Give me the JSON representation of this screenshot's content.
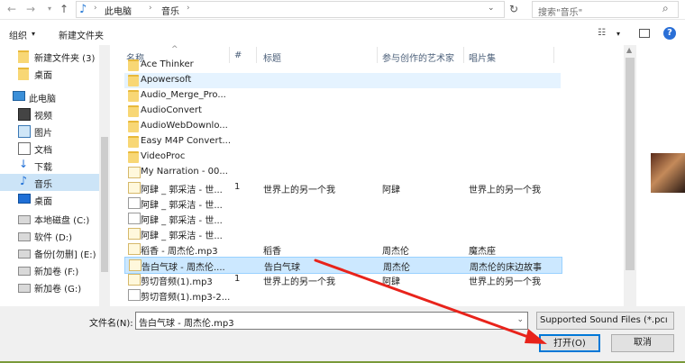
{
  "address": {
    "breadcrumbs": [
      "此电脑",
      "音乐"
    ],
    "search_placeholder": "搜索\"音乐\""
  },
  "toolbar": {
    "organize": "组织",
    "new_folder": "新建文件夹"
  },
  "sidebar": {
    "items": [
      {
        "label": "新建文件夹 (3)",
        "icon": "folder-icon"
      },
      {
        "label": "桌面",
        "icon": "folder-icon"
      },
      {
        "label": "此电脑",
        "icon": "computer-icon"
      },
      {
        "label": "视频",
        "icon": "video-icon"
      },
      {
        "label": "图片",
        "icon": "pictures-icon"
      },
      {
        "label": "文档",
        "icon": "documents-icon"
      },
      {
        "label": "下载",
        "icon": "download-icon"
      },
      {
        "label": "音乐",
        "icon": "music-icon",
        "selected": true
      },
      {
        "label": "桌面",
        "icon": "desktop-icon"
      },
      {
        "label": "本地磁盘 (C:)",
        "icon": "drive-icon"
      },
      {
        "label": "软件 (D:)",
        "icon": "drive-icon"
      },
      {
        "label": "备份[勿删] (E:)",
        "icon": "drive-icon"
      },
      {
        "label": "新加卷 (F:)",
        "icon": "drive-icon"
      },
      {
        "label": "新加卷 (G:)",
        "icon": "drive-icon"
      }
    ]
  },
  "columns": {
    "name": "名称",
    "num": "#",
    "title": "标题",
    "artist": "参与创作的艺术家",
    "album": "唱片集"
  },
  "files": [
    {
      "name": "Ace Thinker",
      "type": "folder",
      "num": "",
      "title": "",
      "artist": "",
      "album": ""
    },
    {
      "name": "Apowersoft",
      "type": "folder",
      "num": "",
      "title": "",
      "artist": "",
      "album": "",
      "hover": true
    },
    {
      "name": "Audio_Merge_Pro...",
      "type": "folder",
      "num": "",
      "title": "",
      "artist": "",
      "album": ""
    },
    {
      "name": "AudioConvert",
      "type": "folder",
      "num": "",
      "title": "",
      "artist": "",
      "album": ""
    },
    {
      "name": "AudioWebDownlo...",
      "type": "folder",
      "num": "",
      "title": "",
      "artist": "",
      "album": ""
    },
    {
      "name": "Easy M4P Convert...",
      "type": "folder",
      "num": "",
      "title": "",
      "artist": "",
      "album": ""
    },
    {
      "name": "VideoProc",
      "type": "folder",
      "num": "",
      "title": "",
      "artist": "",
      "album": ""
    },
    {
      "name": "My Narration - 00...",
      "type": "music",
      "num": "",
      "title": "",
      "artist": "",
      "album": ""
    },
    {
      "name": "阿肆 _ 郭采洁 - 世...",
      "type": "music",
      "num": "1",
      "title": "世界上的另一个我",
      "artist": "阿肆",
      "album": "世界上的另一个我"
    },
    {
      "name": "阿肆 _ 郭采洁 - 世...",
      "type": "doc",
      "num": "",
      "title": "",
      "artist": "",
      "album": ""
    },
    {
      "name": "阿肆 _ 郭采洁 - 世...",
      "type": "doc",
      "num": "",
      "title": "",
      "artist": "",
      "album": ""
    },
    {
      "name": "阿肆 _ 郭采洁 - 世...",
      "type": "music",
      "num": "",
      "title": "",
      "artist": "",
      "album": ""
    },
    {
      "name": "稻香 - 周杰伦.mp3",
      "type": "music",
      "num": "",
      "title": "稻香",
      "artist": "周杰伦",
      "album": "魔杰座"
    },
    {
      "name": "告白气球 - 周杰伦....",
      "type": "music",
      "num": "",
      "title": "告白气球",
      "artist": "周杰伦",
      "album": "周杰伦的床边故事",
      "selected": true
    },
    {
      "name": "剪切音频(1).mp3",
      "type": "music",
      "num": "1",
      "title": "世界上的另一个我",
      "artist": "阿肆",
      "album": "世界上的另一个我"
    },
    {
      "name": "剪切音频(1).mp3-2...",
      "type": "doc",
      "num": "",
      "title": "",
      "artist": "",
      "album": ""
    }
  ],
  "footer": {
    "filename_label": "文件名(N):",
    "filename_value": "告白气球 - 周杰伦.mp3",
    "filter_value": "Supported Sound Files (*.pcı",
    "open_label": "打开(O)",
    "cancel_label": "取消"
  },
  "colors": {
    "accent": "#0078d7",
    "selection": "#cce8ff",
    "annotation_arrow": "#e8231b"
  }
}
